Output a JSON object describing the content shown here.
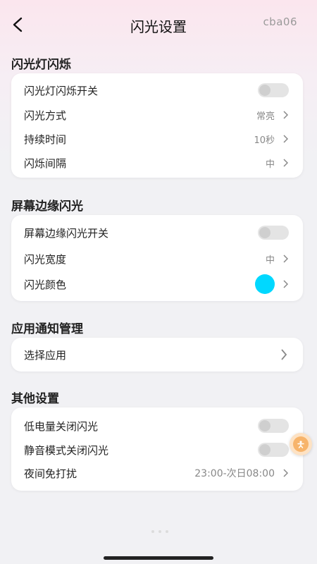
{
  "header": {
    "title": "闪光设置",
    "user_id": "cba06"
  },
  "sections": [
    {
      "title": "闪光灯闪烁",
      "rows": [
        {
          "label": "闪光灯闪烁开关",
          "type": "toggle",
          "on": false
        },
        {
          "label": "闪光方式",
          "value": "常亮"
        },
        {
          "label": "持续时间",
          "value": "10秒"
        },
        {
          "label": "闪烁间隔",
          "value": "中"
        }
      ]
    },
    {
      "title": "屏幕边缘闪光",
      "rows": [
        {
          "label": "屏幕边缘闪光开关",
          "type": "toggle",
          "on": false
        },
        {
          "label": "闪光宽度",
          "value": "中"
        },
        {
          "label": "闪光颜色",
          "type": "color",
          "color": "#00d8ff"
        }
      ]
    },
    {
      "title": "应用通知管理",
      "rows": [
        {
          "label": "选择应用"
        }
      ]
    },
    {
      "title": "其他设置",
      "rows": [
        {
          "label": "低电量关闭闪光",
          "type": "toggle",
          "on": false
        },
        {
          "label": "静音模式关闭闪光",
          "type": "toggle",
          "on": false
        },
        {
          "label": "夜间免打扰",
          "value": "23:00-次日08:00"
        }
      ]
    }
  ],
  "colors": {
    "accent_swatch": "#00d8ff",
    "float_button": "#f7b46b"
  },
  "icons": {
    "back": "chevron-left-icon",
    "row_arrow": "chevron-right-icon",
    "float": "assistant-icon"
  }
}
